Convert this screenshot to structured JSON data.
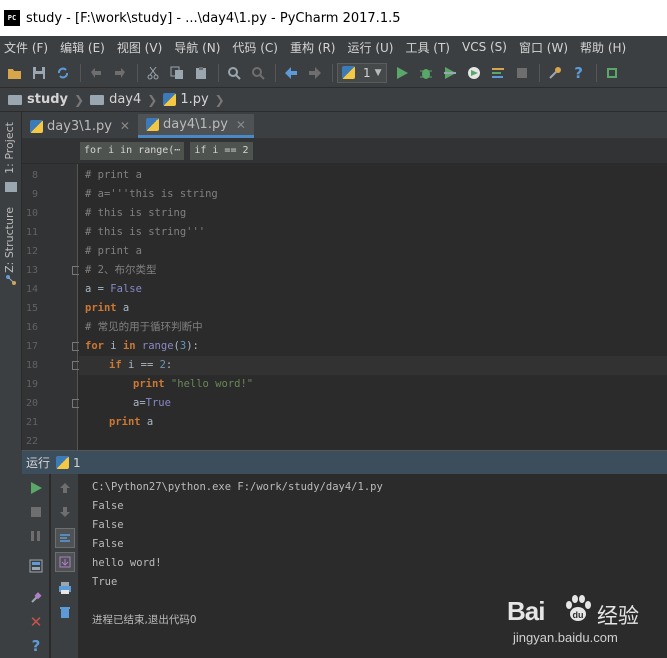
{
  "window": {
    "app_icon": "PC",
    "title": "study - [F:\\work\\study] - ...\\day4\\1.py - PyCharm 2017.1.5"
  },
  "menu": [
    "文件 (F)",
    "编辑 (E)",
    "视图 (V)",
    "导航 (N)",
    "代码 (C)",
    "重构 (R)",
    "运行 (U)",
    "工具 (T)",
    "VCS (S)",
    "窗口 (W)",
    "帮助 (H)"
  ],
  "toolbar": {
    "run_config": "1",
    "icons": [
      "open-folder-icon",
      "save-icon",
      "sync-icon",
      "undo-icon",
      "redo-icon",
      "cut-icon",
      "copy-icon",
      "paste-icon",
      "find-icon",
      "replace-icon",
      "back-icon",
      "forward-icon",
      "run-icon",
      "debug-icon",
      "coverage-icon",
      "profile-icon",
      "concurrency-icon",
      "stop-icon",
      "settings-icon",
      "help-icon",
      "vcs-icon"
    ]
  },
  "breadcrumbs": [
    "study",
    "day4",
    "1.py"
  ],
  "side_tabs": {
    "project": "1: Project",
    "structure": "Z: Structure"
  },
  "editor_tabs": [
    {
      "label": "day3\\1.py",
      "active": false
    },
    {
      "label": "day4\\1.py",
      "active": true
    }
  ],
  "scope": [
    "for i in range(⋯",
    "if i == 2"
  ],
  "code": {
    "line_numbers": [
      "8",
      "9",
      "10",
      "11",
      "12",
      "13",
      "14",
      "15",
      "16",
      "17",
      "18",
      "19",
      "20",
      "21",
      "22"
    ],
    "l8": "# print a",
    "l9": "# a='''this is string",
    "l10": "# this is string",
    "l11": "# this is string'''",
    "l12": "# print a",
    "l13": "# 2、布尔类型",
    "l14_a": "a = ",
    "l14_b": "False",
    "l15_kw": "print",
    "l15_rest": " a",
    "l16": "# 常见的用于循环判断中",
    "l17_for": "for",
    "l17_i": " i ",
    "l17_in": "in",
    "l17_range": " range",
    "l17_p1": "(",
    "l17_num": "3",
    "l17_p2": "):",
    "l18_if": "if",
    "l18_cond": " i == ",
    "l18_num": "2",
    "l18_colon": ":",
    "l19_kw": "print",
    "l19_str": " \"hello word!\"",
    "l20_a": "a=",
    "l20_true": "True",
    "l21_kw": "print",
    "l21_rest": " a"
  },
  "run": {
    "title": "运行",
    "config": "1",
    "output": [
      "C:\\Python27\\python.exe F:/work/study/day4/1.py",
      "False",
      "False",
      "False",
      "hello word!",
      "True",
      "",
      "进程已结束,退出代码0"
    ]
  },
  "watermark": {
    "brand": "Bai",
    "brand2": "经验",
    "url": "jingyan.baidu.com"
  },
  "colors": {
    "background": "#2b2b2b",
    "accent": "#4a88c7",
    "keyword": "#cc7832",
    "string": "#6a8759",
    "number": "#6897bb",
    "comment": "#808080"
  }
}
